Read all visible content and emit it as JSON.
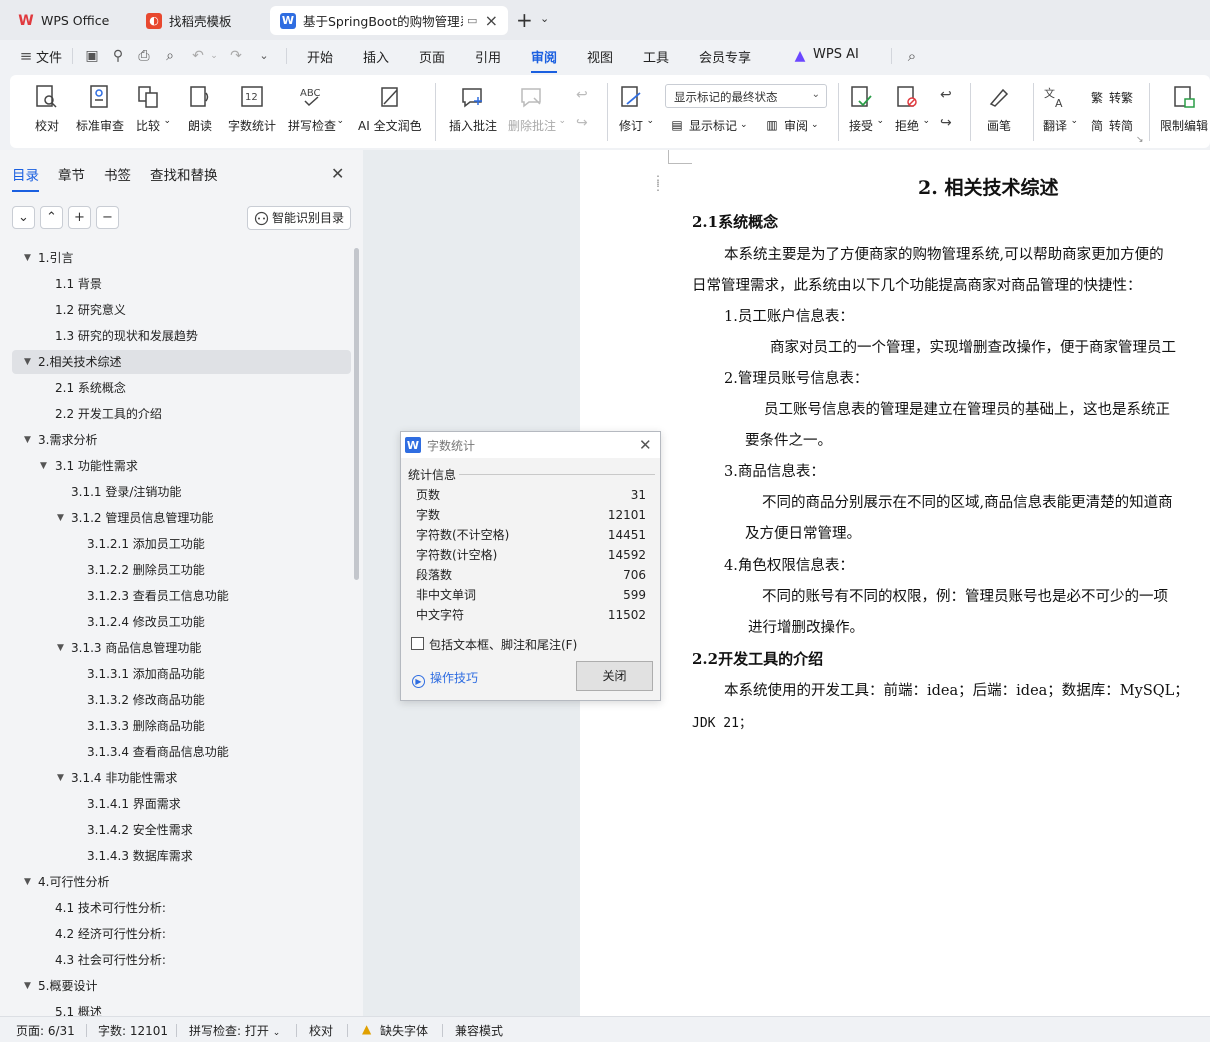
{
  "tabs": [
    {
      "label": "WPS Office"
    },
    {
      "label": "找稻壳模板"
    },
    {
      "label": "基于SpringBoot的购物管理系统"
    }
  ],
  "menubar": {
    "file": "文件",
    "items": [
      "开始",
      "插入",
      "页面",
      "引用",
      "审阅",
      "视图",
      "工具",
      "会员专享"
    ],
    "active": "审阅",
    "wps_ai": "WPS AI"
  },
  "ribbon": {
    "proofread": "校对",
    "std_review": "标准审查",
    "compare": "比较",
    "read_aloud": "朗读",
    "word_count": "字数统计",
    "spell_check": "拼写检查",
    "ai_polish": "AI 全文润色",
    "insert_comment": "插入批注",
    "delete_comment": "删除批注",
    "track_changes": "修订",
    "markup_mode": "显示标记的最终状态",
    "show_markup": "显示标记",
    "review_pane": "审阅",
    "accept": "接受",
    "reject": "拒绝",
    "pen": "画笔",
    "translate": "翻译",
    "to_traditional": "转繁",
    "to_simplified": "转简",
    "restrict_edit": "限制编辑"
  },
  "nav_panel": {
    "tabs": [
      "目录",
      "章节",
      "书签",
      "查找和替换"
    ],
    "active_tab": "目录",
    "smart_toc": "智能识别目录",
    "toc": [
      {
        "label": "1.引言",
        "level": 1,
        "tri": true
      },
      {
        "label": "1.1 背景",
        "level": 2
      },
      {
        "label": "1.2 研究意义",
        "level": 2
      },
      {
        "label": "1.3 研究的现状和发展趋势",
        "level": 2
      },
      {
        "label": "2.相关技术综述",
        "level": 1,
        "tri": true,
        "selected": true
      },
      {
        "label": "2.1 系统概念",
        "level": 2
      },
      {
        "label": "2.2 开发工具的介绍",
        "level": 2
      },
      {
        "label": "3.需求分析",
        "level": 1,
        "tri": true
      },
      {
        "label": "3.1 功能性需求",
        "level": 2,
        "tri": true
      },
      {
        "label": "3.1.1 登录/注销功能",
        "level": 3
      },
      {
        "label": "3.1.2 管理员信息管理功能",
        "level": 3,
        "tri": true
      },
      {
        "label": "3.1.2.1 添加员工功能",
        "level": 4
      },
      {
        "label": "3.1.2.2 删除员工功能",
        "level": 4
      },
      {
        "label": "3.1.2.3 查看员工信息功能",
        "level": 4
      },
      {
        "label": "3.1.2.4 修改员工功能",
        "level": 4
      },
      {
        "label": "3.1.3 商品信息管理功能",
        "level": 3,
        "tri": true
      },
      {
        "label": "3.1.3.1 添加商品功能",
        "level": 4
      },
      {
        "label": "3.1.3.2 修改商品功能",
        "level": 4
      },
      {
        "label": "3.1.3.3 删除商品功能",
        "level": 4
      },
      {
        "label": "3.1.3.4 查看商品信息功能",
        "level": 4
      },
      {
        "label": "3.1.4 非功能性需求",
        "level": 3,
        "tri": true
      },
      {
        "label": "3.1.4.1 界面需求",
        "level": 4
      },
      {
        "label": "3.1.4.2 安全性需求",
        "level": 4
      },
      {
        "label": "3.1.4.3 数据库需求",
        "level": 4
      },
      {
        "label": "4.可行性分析",
        "level": 1,
        "tri": true
      },
      {
        "label": "4.1 技术可行性分析:",
        "level": 2
      },
      {
        "label": "4.2 经济可行性分析:",
        "level": 2
      },
      {
        "label": "4.3 社会可行性分析:",
        "level": 2
      },
      {
        "label": "5.概要设计",
        "level": 1,
        "tri": true
      },
      {
        "label": "5.1 概述",
        "level": 2
      }
    ]
  },
  "document": {
    "heading": "2. 相关技术综述",
    "s21": "2.1系统概念",
    "p1a": "本系统主要是为了方便商家的购物管理系统,可以帮助商家更加方便的",
    "p1b": "日常管理需求，此系统由以下几个功能提高商家对商品管理的快捷性：",
    "i1": "1.员工账户信息表：",
    "i1d": "商家对员工的一个管理，实现增删查改操作，便于商家管理员工",
    "i2": "2.管理员账号信息表：",
    "i2d": "员工账号信息表的管理是建立在管理员的基础上，这也是系统正",
    "i2e": "要条件之一。",
    "i3": "3.商品信息表：",
    "i3d": "不同的商品分别展示在不同的区域,商品信息表能更清楚的知道商",
    "i3e": "及方便日常管理。",
    "i4": "4.角色权限信息表：",
    "i4d": "不同的账号有不同的权限，例：管理员账号也是必不可少的一项",
    "i4e": "进行增删改操作。",
    "s22": "2.2开发工具的介绍",
    "p2a": "本系统使用的开发工具：前端：idea；后端：idea；数据库：MySQL；",
    "p2b": "JDK 21；"
  },
  "dialog": {
    "title": "字数统计",
    "group": "统计信息",
    "rows": [
      {
        "label": "页数",
        "value": "31"
      },
      {
        "label": "字数",
        "value": "12101"
      },
      {
        "label": "字符数(不计空格)",
        "value": "14451"
      },
      {
        "label": "字符数(计空格)",
        "value": "14592"
      },
      {
        "label": "段落数",
        "value": "706"
      },
      {
        "label": "非中文单词",
        "value": "599"
      },
      {
        "label": "中文字符",
        "value": "11502"
      }
    ],
    "checkbox": "包括文本框、脚注和尾注(F)",
    "tips": "操作技巧",
    "close": "关闭"
  },
  "statusbar": {
    "page": "页面: 6/31",
    "words": "字数: 12101",
    "spell": "拼写检查: 打开",
    "proof": "校对",
    "missing_font": "缺失字体",
    "compat": "兼容模式"
  },
  "colors": {
    "accent": "#1a5fe0",
    "wps_red": "#e0393e",
    "docer_red": "#e8482f",
    "writer_blue": "#2f6de1"
  }
}
